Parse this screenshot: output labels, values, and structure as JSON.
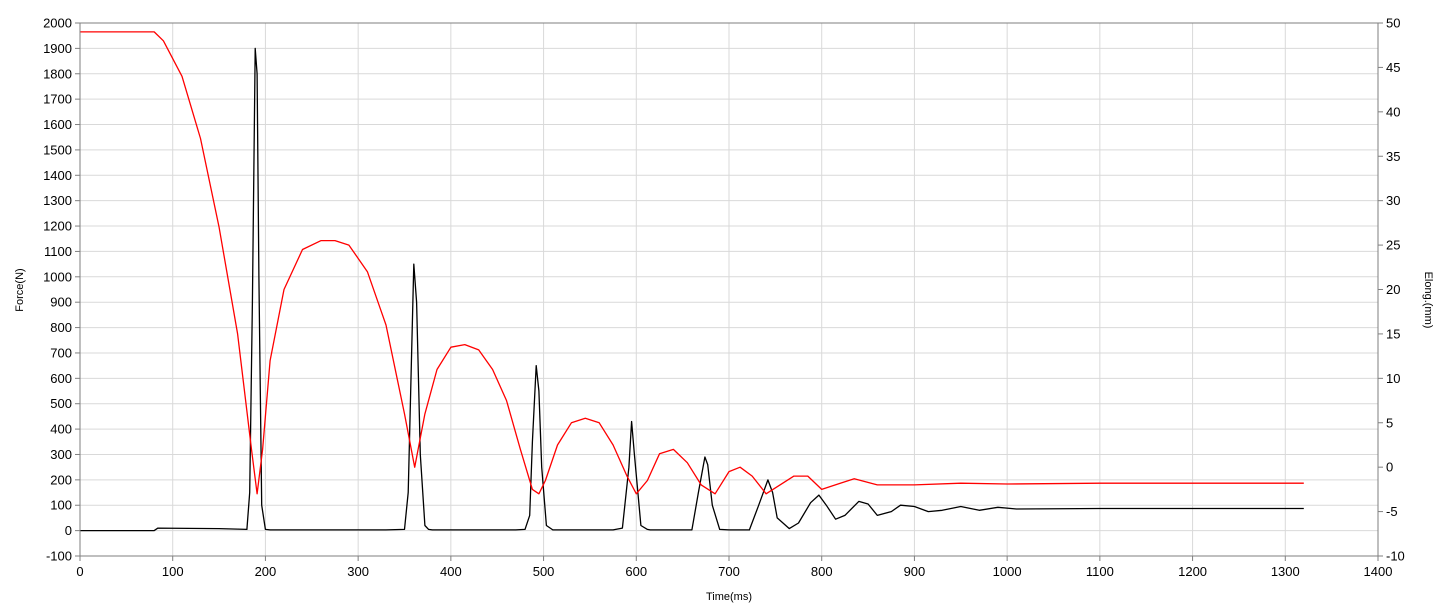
{
  "chart_data": {
    "type": "line",
    "xlabel": "Time(ms)",
    "ylabel_left": "Force(N)",
    "ylabel_right": "Elong.(mm)",
    "xlim": [
      0,
      1400
    ],
    "ylim_left": [
      -100,
      2000
    ],
    "ylim_right": [
      -10,
      50
    ],
    "x_ticks": [
      "0",
      "100",
      "200",
      "300",
      "400",
      "500",
      "600",
      "700",
      "800",
      "900",
      "1000",
      "1100",
      "1200",
      "1300",
      "1400"
    ],
    "y_left_ticks": [
      "-100",
      "0",
      "100",
      "200",
      "300",
      "400",
      "500",
      "600",
      "700",
      "800",
      "900",
      "1000",
      "1100",
      "1200",
      "1300",
      "1400",
      "1500",
      "1600",
      "1700",
      "1800",
      "1900",
      "2000"
    ],
    "y_right_ticks": [
      "-10",
      "-5",
      "0",
      "5",
      "10",
      "15",
      "20",
      "25",
      "30",
      "35",
      "40",
      "45",
      "50"
    ],
    "grid": true,
    "series": [
      {
        "axis": "left",
        "color": "#000000",
        "x": [
          0,
          80,
          84,
          150,
          180,
          183,
          186,
          189,
          191,
          193,
          196,
          200,
          205,
          210,
          330,
          350,
          354,
          357,
          360,
          363,
          367,
          372,
          376,
          380,
          470,
          480,
          485,
          488,
          492,
          495,
          498,
          503,
          510,
          575,
          585,
          592,
          595,
          598,
          605,
          612,
          615,
          660,
          667,
          674,
          677,
          682,
          690,
          700,
          722,
          732,
          742,
          747,
          752,
          765,
          775,
          788,
          797,
          805,
          815,
          825,
          840,
          850,
          860,
          875,
          885,
          900,
          915,
          930,
          950,
          970,
          990,
          1010,
          1100,
          1200,
          1320
        ],
        "values": [
          0,
          0,
          10,
          8,
          5,
          150,
          900,
          1900,
          1800,
          1000,
          100,
          5,
          3,
          3,
          3,
          5,
          150,
          600,
          1050,
          900,
          300,
          20,
          5,
          3,
          3,
          5,
          60,
          350,
          650,
          550,
          250,
          20,
          3,
          3,
          10,
          250,
          430,
          300,
          20,
          5,
          3,
          3,
          150,
          290,
          260,
          100,
          5,
          3,
          3,
          100,
          200,
          150,
          50,
          8,
          30,
          110,
          140,
          100,
          45,
          60,
          115,
          105,
          60,
          75,
          100,
          95,
          75,
          80,
          95,
          80,
          92,
          85,
          87,
          87,
          87
        ]
      },
      {
        "axis": "right",
        "color": "#ff0000",
        "x": [
          0,
          80,
          90,
          110,
          130,
          150,
          170,
          185,
          191,
          197,
          205,
          220,
          240,
          260,
          275,
          290,
          310,
          330,
          350,
          361,
          372,
          385,
          400,
          415,
          430,
          445,
          460,
          475,
          488,
          495,
          502,
          515,
          530,
          545,
          560,
          575,
          590,
          600,
          612,
          625,
          640,
          655,
          670,
          685,
          700,
          712,
          725,
          740,
          755,
          770,
          785,
          800,
          820,
          835,
          860,
          900,
          950,
          1000,
          1100,
          1200,
          1320
        ],
        "values": [
          49,
          49,
          48,
          44,
          37,
          27,
          15,
          2,
          -3,
          2,
          12,
          20,
          24.5,
          25.5,
          25.5,
          25,
          22,
          16,
          6,
          0,
          6,
          11,
          13.5,
          13.8,
          13.2,
          11,
          7.5,
          2,
          -2.5,
          -3,
          -1.5,
          2.5,
          5,
          5.5,
          5,
          2.5,
          -1,
          -3,
          -1.5,
          1.5,
          2,
          0.5,
          -2,
          -3,
          -0.5,
          0,
          -1,
          -3,
          -2,
          -1,
          -1,
          -2.5,
          -1.8,
          -1.3,
          -2,
          -2,
          -1.8,
          -1.9,
          -1.8,
          -1.8,
          -1.8
        ]
      }
    ]
  }
}
